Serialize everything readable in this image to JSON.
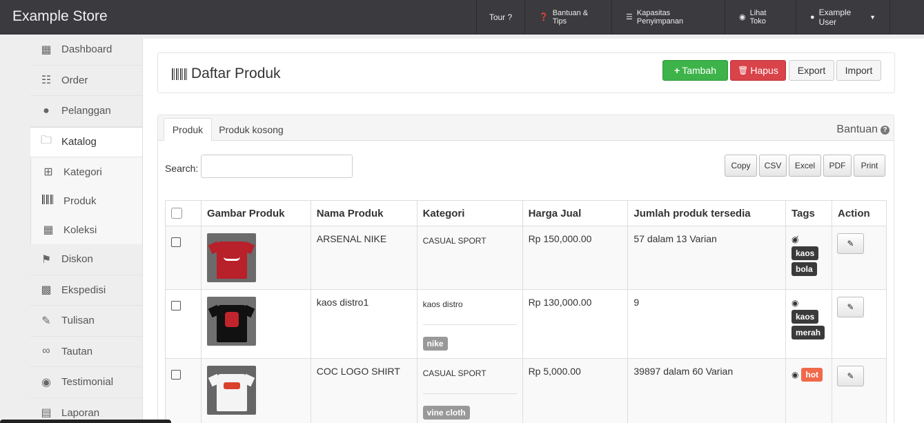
{
  "navbar": {
    "brand": "Example Store",
    "items": [
      {
        "label": "Tour ?",
        "icon": "",
        "name": "tour"
      },
      {
        "label": "Bantuan & Tips",
        "icon": "question-circle-icon",
        "glyph": "❓",
        "name": "help-tips"
      },
      {
        "label": "Kapasitas Penyimpanan",
        "icon": "storage-icon",
        "glyph": "☰",
        "name": "storage-capacity"
      },
      {
        "label": "Lihat Toko",
        "icon": "globe-icon",
        "glyph": "🌐",
        "name": "view-store"
      },
      {
        "label": "Example User",
        "icon": "user-icon",
        "glyph": "👤",
        "name": "user-menu"
      }
    ]
  },
  "sidebar": {
    "items": [
      {
        "label": "Dashboard",
        "icon": "bar-chart-icon",
        "glyph": "📊"
      },
      {
        "label": "Order",
        "icon": "cart-icon",
        "glyph": "🛒"
      },
      {
        "label": "Pelanggan",
        "icon": "users-icon",
        "glyph": "👥"
      },
      {
        "label": "Katalog",
        "icon": "folder-icon",
        "glyph": "🗀"
      },
      {
        "label": "Kategori",
        "icon": "sitemap-icon",
        "glyph": "⊞"
      },
      {
        "label": "Produk",
        "icon": "barcode-icon",
        "glyph": "║"
      },
      {
        "label": "Koleksi",
        "icon": "grid-icon",
        "glyph": "▦"
      },
      {
        "label": "Diskon",
        "icon": "tags-icon",
        "glyph": "🏷"
      },
      {
        "label": "Ekspedisi",
        "icon": "truck-icon",
        "glyph": "🚚"
      },
      {
        "label": "Tulisan",
        "icon": "pencil-icon",
        "glyph": "✎"
      },
      {
        "label": "Tautan",
        "icon": "link-icon",
        "glyph": "🔗"
      },
      {
        "label": "Testimonial",
        "icon": "comments-icon",
        "glyph": "💬"
      },
      {
        "label": "Laporan",
        "icon": "book-icon",
        "glyph": "📘"
      }
    ]
  },
  "header": {
    "title": "Daftar Produk",
    "buttons": {
      "add": "Tambah",
      "delete": "Hapus",
      "export": "Export",
      "import": "Import"
    }
  },
  "tabs": {
    "items": [
      "Produk",
      "Produk kosong"
    ],
    "help": "Bantuan"
  },
  "search": {
    "label": "Search:",
    "value": ""
  },
  "export_buttons": [
    "Copy",
    "CSV",
    "Excel",
    "PDF",
    "Print"
  ],
  "table": {
    "headers": [
      "Gambar Produk",
      "Nama Produk",
      "Kategori",
      "Harga Jual",
      "Jumlah produk tersedia",
      "Tags",
      "Action"
    ],
    "rows": [
      {
        "name": "ARSENAL NIKE",
        "category": "CASUAL SPORT",
        "sub_tag": "",
        "price": "Rp 150,000.00",
        "stock": "57 dalam 13 Varian",
        "visibility": "hidden",
        "tags": [
          "kaos",
          "bola"
        ],
        "shirt_color": "#b8202a",
        "bg": "#6b6b6b"
      },
      {
        "name": "kaos distro1",
        "category": "kaos distro",
        "sub_tag": "nike",
        "price": "Rp 130,000.00",
        "stock": "9",
        "visibility": "visible",
        "tags": [
          "kaos",
          "merah"
        ],
        "shirt_color": "#111111",
        "bg": "#707070"
      },
      {
        "name": "COC LOGO SHIRT",
        "category": "CASUAL SPORT",
        "sub_tag": "vine cloth",
        "price": "Rp 5,000.00",
        "stock": "39897 dalam 60 Varian",
        "visibility": "visible",
        "tags": [
          "hot"
        ],
        "shirt_color": "#f4f4f4",
        "bg": "#666666"
      }
    ]
  }
}
